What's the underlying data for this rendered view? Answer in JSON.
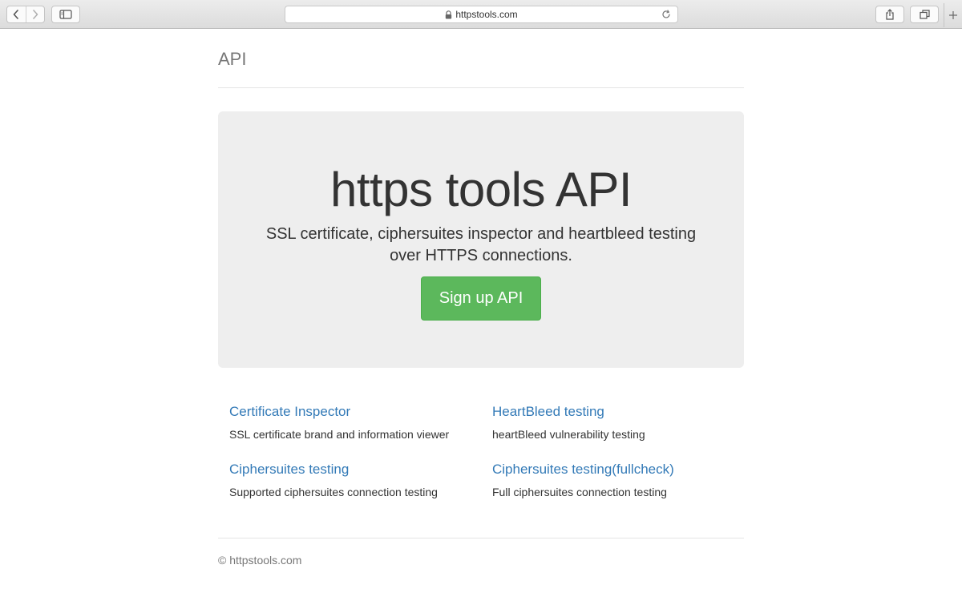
{
  "browser": {
    "url": "httpstools.com",
    "icons": {
      "back": "chevron-left-icon",
      "forward": "chevron-right-icon",
      "sidebar": "sidebar-icon",
      "lock": "lock-icon",
      "reload": "reload-icon",
      "share": "share-icon",
      "tabs": "tabs-icon",
      "new_tab": "plus-icon"
    }
  },
  "header": {
    "brand": "API"
  },
  "hero": {
    "title": "https tools API",
    "lead": "SSL certificate, ciphersuites inspector and heartbleed testing over HTTPS connections.",
    "button_label": "Sign up API",
    "button_color": "#5cb85c"
  },
  "features": [
    {
      "title": "Certificate Inspector",
      "description": "SSL certificate brand and information viewer"
    },
    {
      "title": "HeartBleed testing",
      "description": "heartBleed vulnerability testing"
    },
    {
      "title": "Ciphersuites testing",
      "description": "Supported ciphersuites connection testing"
    },
    {
      "title": "Ciphersuites testing(fullcheck)",
      "description": "Full ciphersuites connection testing"
    }
  ],
  "footer": {
    "text": "© httpstools.com"
  },
  "colors": {
    "link": "#337ab7",
    "jumbotron_bg": "#eeeeee",
    "muted_text": "#777777"
  }
}
